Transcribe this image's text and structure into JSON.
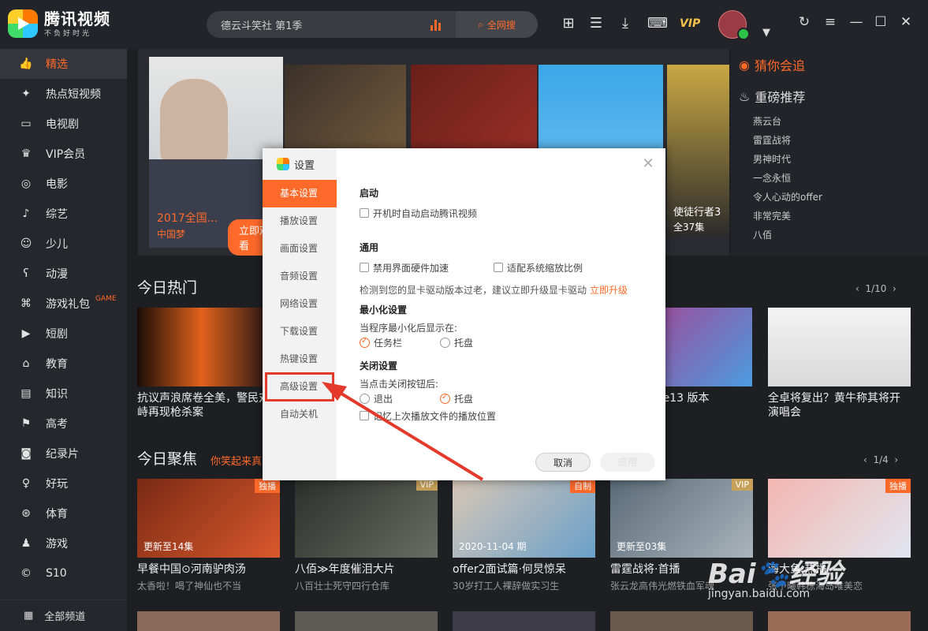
{
  "app": {
    "name": "腾讯视频",
    "slogan": "不负好时光"
  },
  "search": {
    "query": "德云斗笑社 第1季",
    "button": "全网搜"
  },
  "toolbar": {
    "vip": "VIP"
  },
  "sidebar": {
    "items": [
      {
        "label": "精选",
        "icon": "thumb-up-icon"
      },
      {
        "label": "热点短视频",
        "icon": "hot-icon"
      },
      {
        "label": "电视剧",
        "icon": "tv-icon"
      },
      {
        "label": "VIP会员",
        "icon": "vip-icon"
      },
      {
        "label": "电影",
        "icon": "film-icon"
      },
      {
        "label": "综艺",
        "icon": "mic-icon"
      },
      {
        "label": "少儿",
        "icon": "kid-icon"
      },
      {
        "label": "动漫",
        "icon": "anime-icon"
      },
      {
        "label": "游戏礼包",
        "icon": "gamepad-icon",
        "tag": "GAME"
      },
      {
        "label": "短剧",
        "icon": "play-icon"
      },
      {
        "label": "教育",
        "icon": "edu-icon"
      },
      {
        "label": "知识",
        "icon": "book-icon"
      },
      {
        "label": "高考",
        "icon": "cap-icon"
      },
      {
        "label": "纪录片",
        "icon": "camera-icon"
      },
      {
        "label": "好玩",
        "icon": "fun-icon"
      },
      {
        "label": "体育",
        "icon": "ball-icon"
      },
      {
        "label": "游戏",
        "icon": "joystick-icon"
      },
      {
        "label": "S10",
        "icon": "s10-icon"
      }
    ],
    "all": "全部频道"
  },
  "banner": {
    "title": "2017全国...",
    "caption": "中国梦",
    "watch": "立即观看",
    "side_title": "使徒行者3",
    "side_eps": "全37集"
  },
  "hotlist": {
    "guess": "猜你会追",
    "recommend": "重磅推荐",
    "items": [
      "燕云台",
      "雷霆战将",
      "男神时代",
      "一念永恒",
      "令人心动的offer",
      "非常完美",
      "八佰"
    ]
  },
  "today_hot": {
    "title": "今日热门",
    "pager": "1/10",
    "cards": [
      {
        "title": "抗议声浪席卷全美，警民对峙再现枪杀案"
      },
      {
        "title": "了？iPhone13 版本"
      },
      {
        "title": "全卓将复出？黄牛称其将开演唱会"
      }
    ]
  },
  "today_focus": {
    "title": "今日聚焦",
    "subtitle": "你笑起来真",
    "pager": "1/4",
    "cards": [
      {
        "title": "早餐中国⊙河南驴肉汤",
        "sub": "太香啦！喝了神仙也不当",
        "tag": "独播",
        "over": "更新至14集"
      },
      {
        "title": "八佰≫年度催泪大片",
        "sub": "八百壮士死守四行仓库",
        "tag": "VIP",
        "over": ""
      },
      {
        "title": "offer2面试篇·何炅惊呆",
        "sub": "30岁打工人裸辞做实习生",
        "tag": "自制",
        "over": "2020-11-04 期"
      },
      {
        "title": "雷霆战将·首播",
        "sub": "张云龙高伟光燃铁血军魂",
        "tag": "VIP",
        "over": "更新至03集"
      },
      {
        "title": "海大鱼·热播",
        "sub": "张予曦韩栋海岛唯美恋",
        "tag": "独播",
        "over": ""
      }
    ]
  },
  "dialog": {
    "title": "设置",
    "nav": [
      "基本设置",
      "播放设置",
      "画面设置",
      "音频设置",
      "网络设置",
      "下载设置",
      "热键设置",
      "高级设置",
      "自动关机"
    ],
    "startup": {
      "title": "启动",
      "autostart": "开机时自动启动腾讯视频"
    },
    "general": {
      "title": "通用",
      "disable_hw": "禁用界面硬件加速",
      "fit_scale": "适配系统缩放比例",
      "notice": "检测到您的显卡驱动版本过老，建议立即升级显卡驱动",
      "upgrade": "立即升级"
    },
    "minimize": {
      "title": "最小化设置",
      "desc": "当程序最小化后显示在:",
      "taskbar": "任务栏",
      "tray": "托盘"
    },
    "close": {
      "title": "关闭设置",
      "desc": "当点击关闭按钮后:",
      "exit": "退出",
      "tray": "托盘",
      "remember": "记忆上次播放文件的播放位置"
    },
    "cancel": "取消",
    "apply": "应用"
  },
  "watermark": {
    "logo": "Bai🐾经验",
    "sub": "jingyan.baidu.com"
  }
}
